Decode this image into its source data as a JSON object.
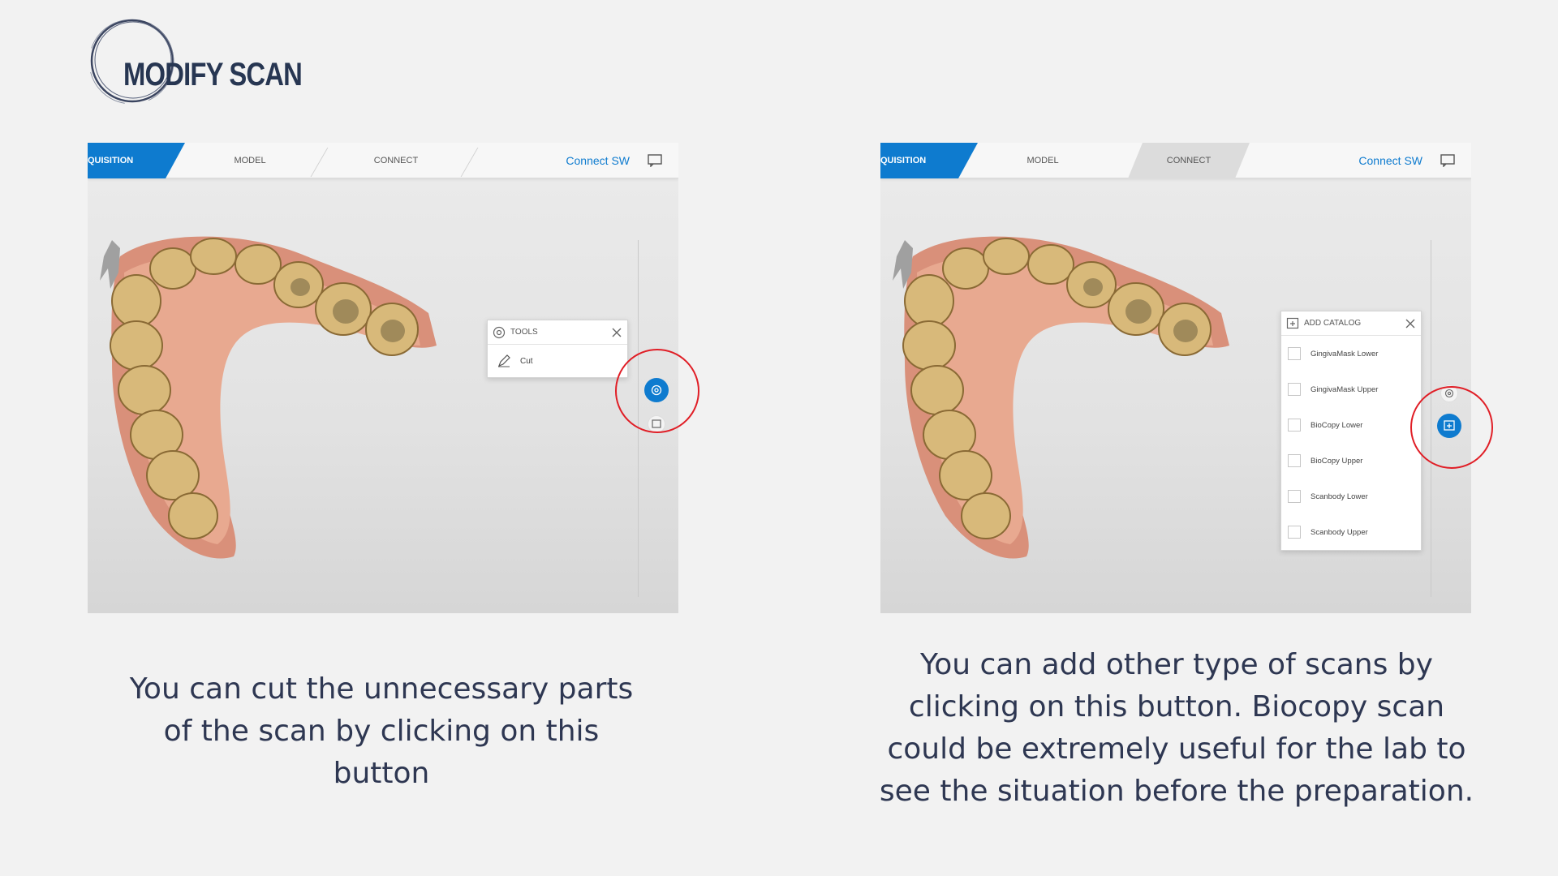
{
  "header": {
    "title": "MODIFY SCAN"
  },
  "left_panel": {
    "tabs": {
      "acquisition": "QUISITION",
      "model": "MODEL",
      "connect": "CONNECT"
    },
    "connect_sw": "Connect SW",
    "tools_popup": {
      "title": "TOOLS",
      "items": [
        "Cut"
      ]
    },
    "caption": "You can cut the unnecessary parts of the scan by clicking on this button"
  },
  "right_panel": {
    "tabs": {
      "acquisition": "QUISITION",
      "model": "MODEL",
      "connect": "CONNECT"
    },
    "connect_sw": "Connect SW",
    "catalog_popup": {
      "title": "ADD CATALOG",
      "items": [
        "GingivaMask Lower",
        "GingivaMask Upper",
        "BioCopy Lower",
        "BioCopy Upper",
        "Scanbody Lower",
        "Scanbody Upper"
      ]
    },
    "caption": "You can add other type of scans by clicking on this button. Biocopy scan could be extremely useful for the lab to see the situation before the preparation."
  },
  "colors": {
    "accent": "#0e7bcf",
    "highlight_ring": "#e01e26",
    "text": "#2e3752"
  }
}
